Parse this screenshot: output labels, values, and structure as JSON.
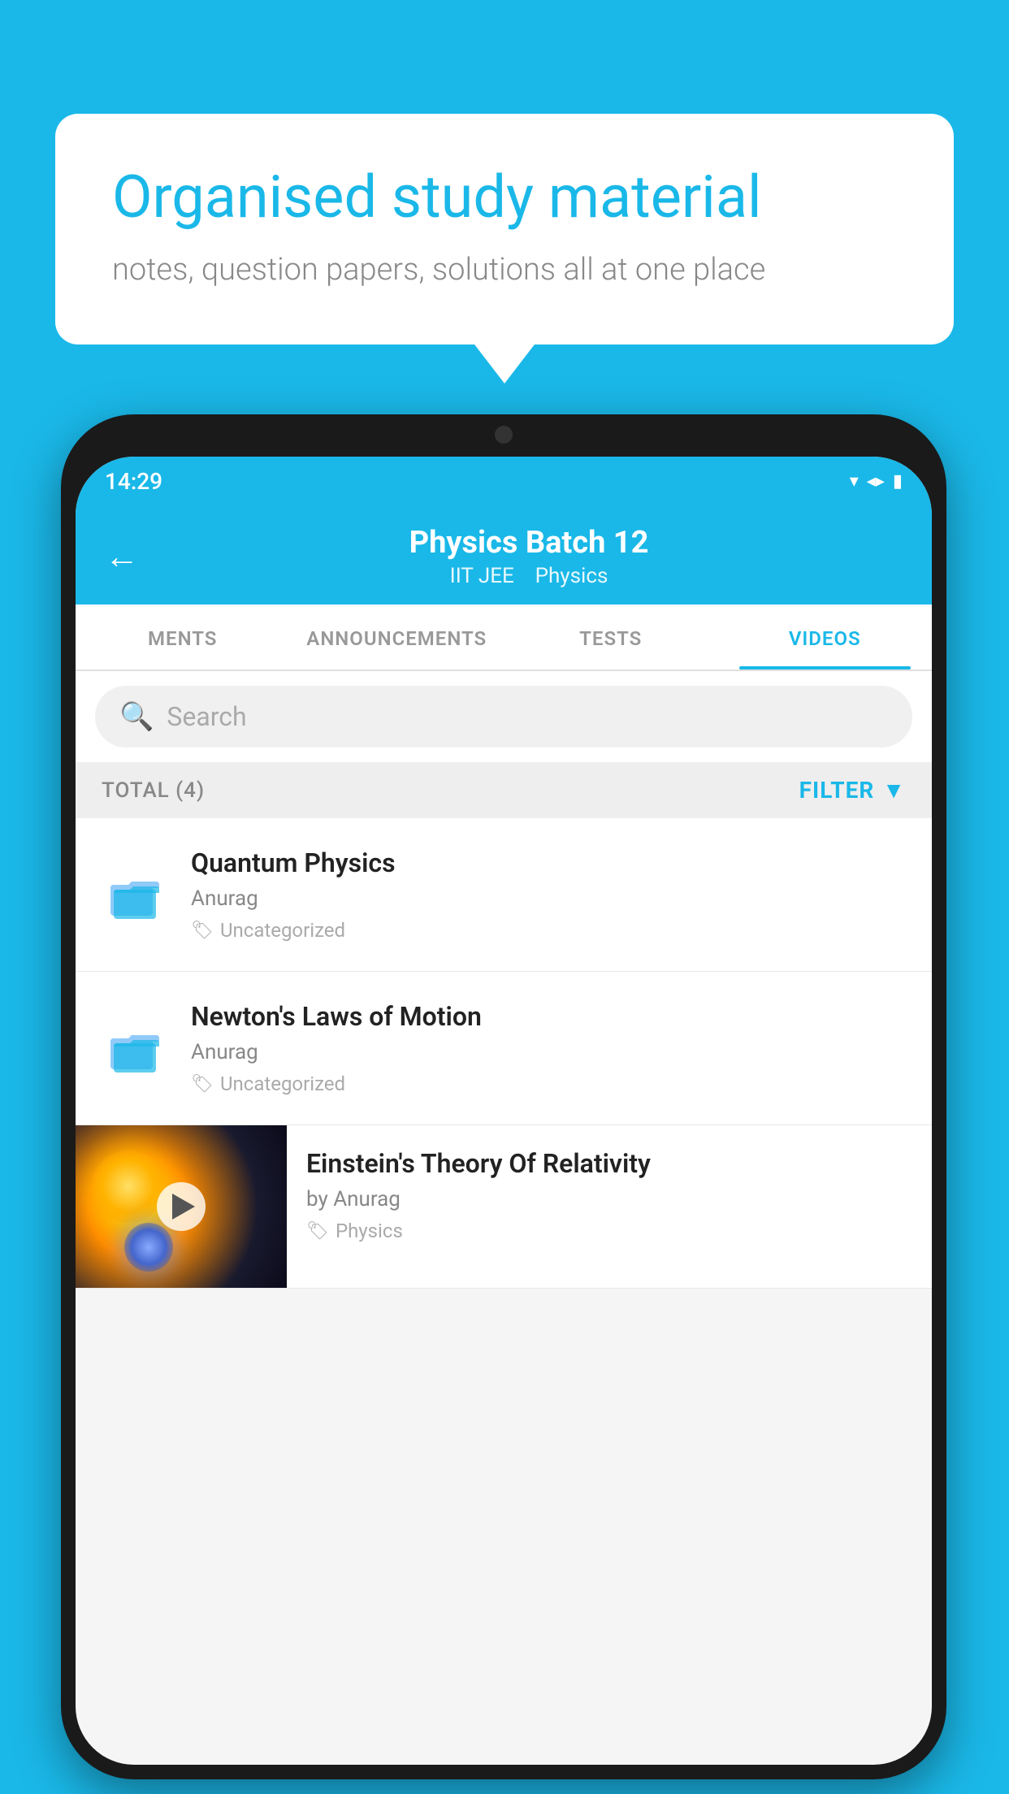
{
  "background_color": "#1ab8e8",
  "bubble": {
    "title": "Organised study material",
    "subtitle": "notes, question papers, solutions all at one place"
  },
  "phone": {
    "status_bar": {
      "time": "14:29",
      "signal_icons": "▼◄▌"
    },
    "header": {
      "title": "Physics Batch 12",
      "subtitle_part1": "IIT JEE",
      "subtitle_part2": "Physics",
      "back_label": "←"
    },
    "tabs": [
      {
        "label": "MENTS",
        "active": false
      },
      {
        "label": "ANNOUNCEMENTS",
        "active": false
      },
      {
        "label": "TESTS",
        "active": false
      },
      {
        "label": "VIDEOS",
        "active": true
      }
    ],
    "search": {
      "placeholder": "Search"
    },
    "filter_bar": {
      "total_label": "TOTAL (4)",
      "filter_label": "FILTER"
    },
    "videos": [
      {
        "id": "quantum",
        "title": "Quantum Physics",
        "author": "Anurag",
        "tag": "Uncategorized",
        "type": "folder"
      },
      {
        "id": "newton",
        "title": "Newton's Laws of Motion",
        "author": "Anurag",
        "tag": "Uncategorized",
        "type": "folder"
      },
      {
        "id": "einstein",
        "title": "Einstein's Theory Of Relativity",
        "author": "by Anurag",
        "tag": "Physics",
        "type": "video"
      }
    ]
  }
}
